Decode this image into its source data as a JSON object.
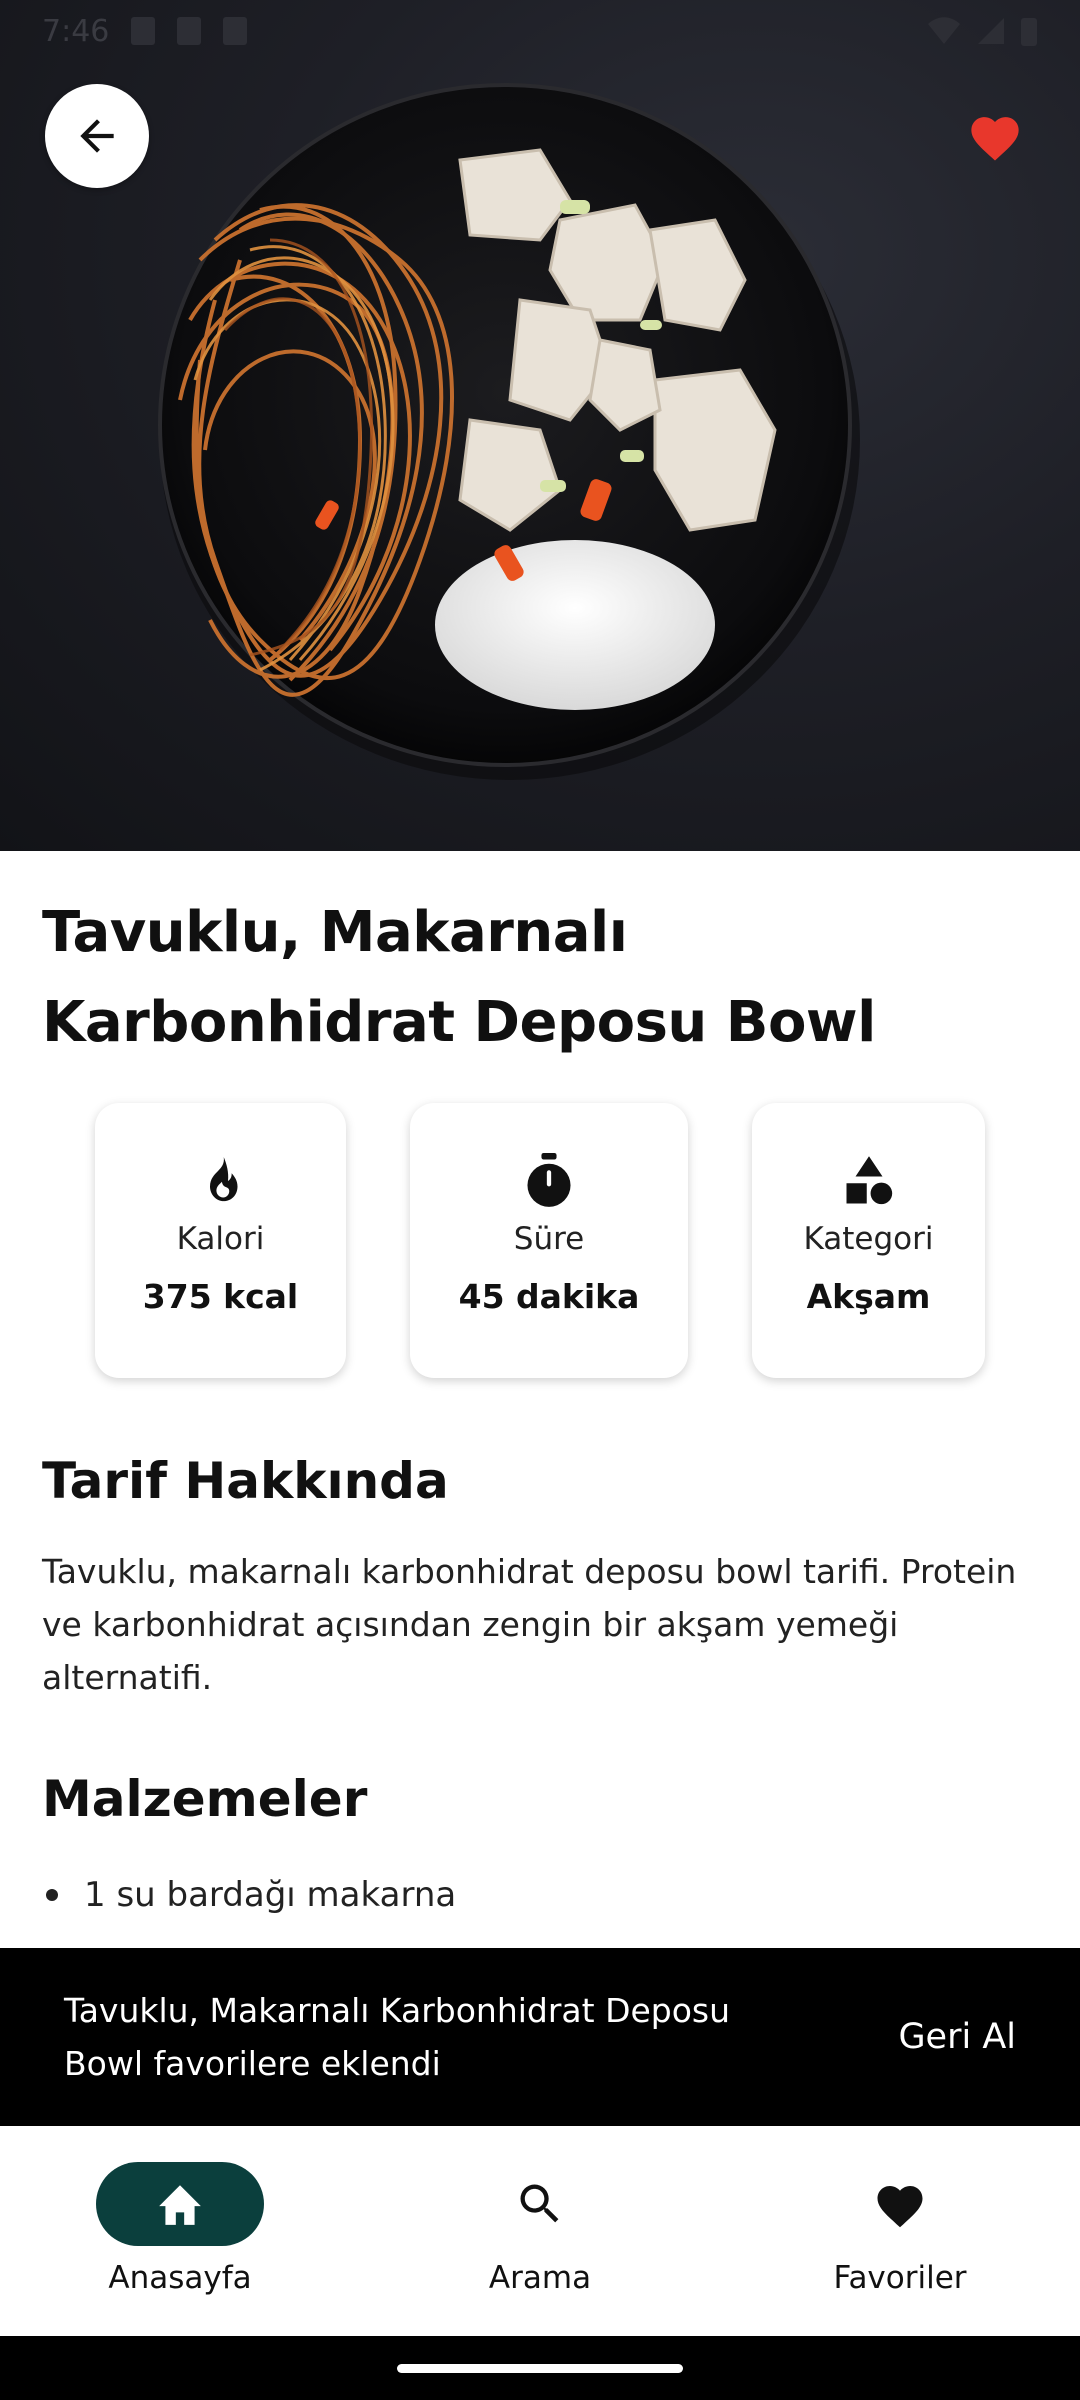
{
  "status_bar": {
    "time": "7:46"
  },
  "hero": {
    "image_alt": "Noodles, chicken and rice in a black bowl"
  },
  "favorite": {
    "active": true,
    "color": "#e8372c"
  },
  "recipe": {
    "title": "Tavuklu, Makarnalı Karbonhidrat Deposu Bowl",
    "stats": [
      {
        "icon": "flame-icon",
        "label": "Kalori",
        "value": "375 kcal"
      },
      {
        "icon": "timer-icon",
        "label": "Süre",
        "value": "45 dakika"
      },
      {
        "icon": "category-shapes-icon",
        "label": "Kategori",
        "value": "Akşam"
      }
    ],
    "about_heading": "Tarif Hakkında",
    "about_text": "Tavuklu, makarnalı karbonhidrat deposu bowl tarifi. Protein ve karbonhidrat açısından zengin bir akşam yemeği alternatifi.",
    "ingredients_heading": "Malzemeler",
    "ingredients": [
      "1 su bardağı makarna"
    ]
  },
  "snackbar": {
    "message": "Tavuklu, Makarnalı Karbonhidrat Deposu Bowl favorilere eklendi",
    "action": "Geri Al"
  },
  "nav": {
    "accent": "#0b3f3d",
    "items": [
      {
        "label": "Anasayfa",
        "icon": "home-icon",
        "active": true
      },
      {
        "label": "Arama",
        "icon": "search-icon",
        "active": false
      },
      {
        "label": "Favoriler",
        "icon": "heart-icon",
        "active": false
      }
    ]
  }
}
